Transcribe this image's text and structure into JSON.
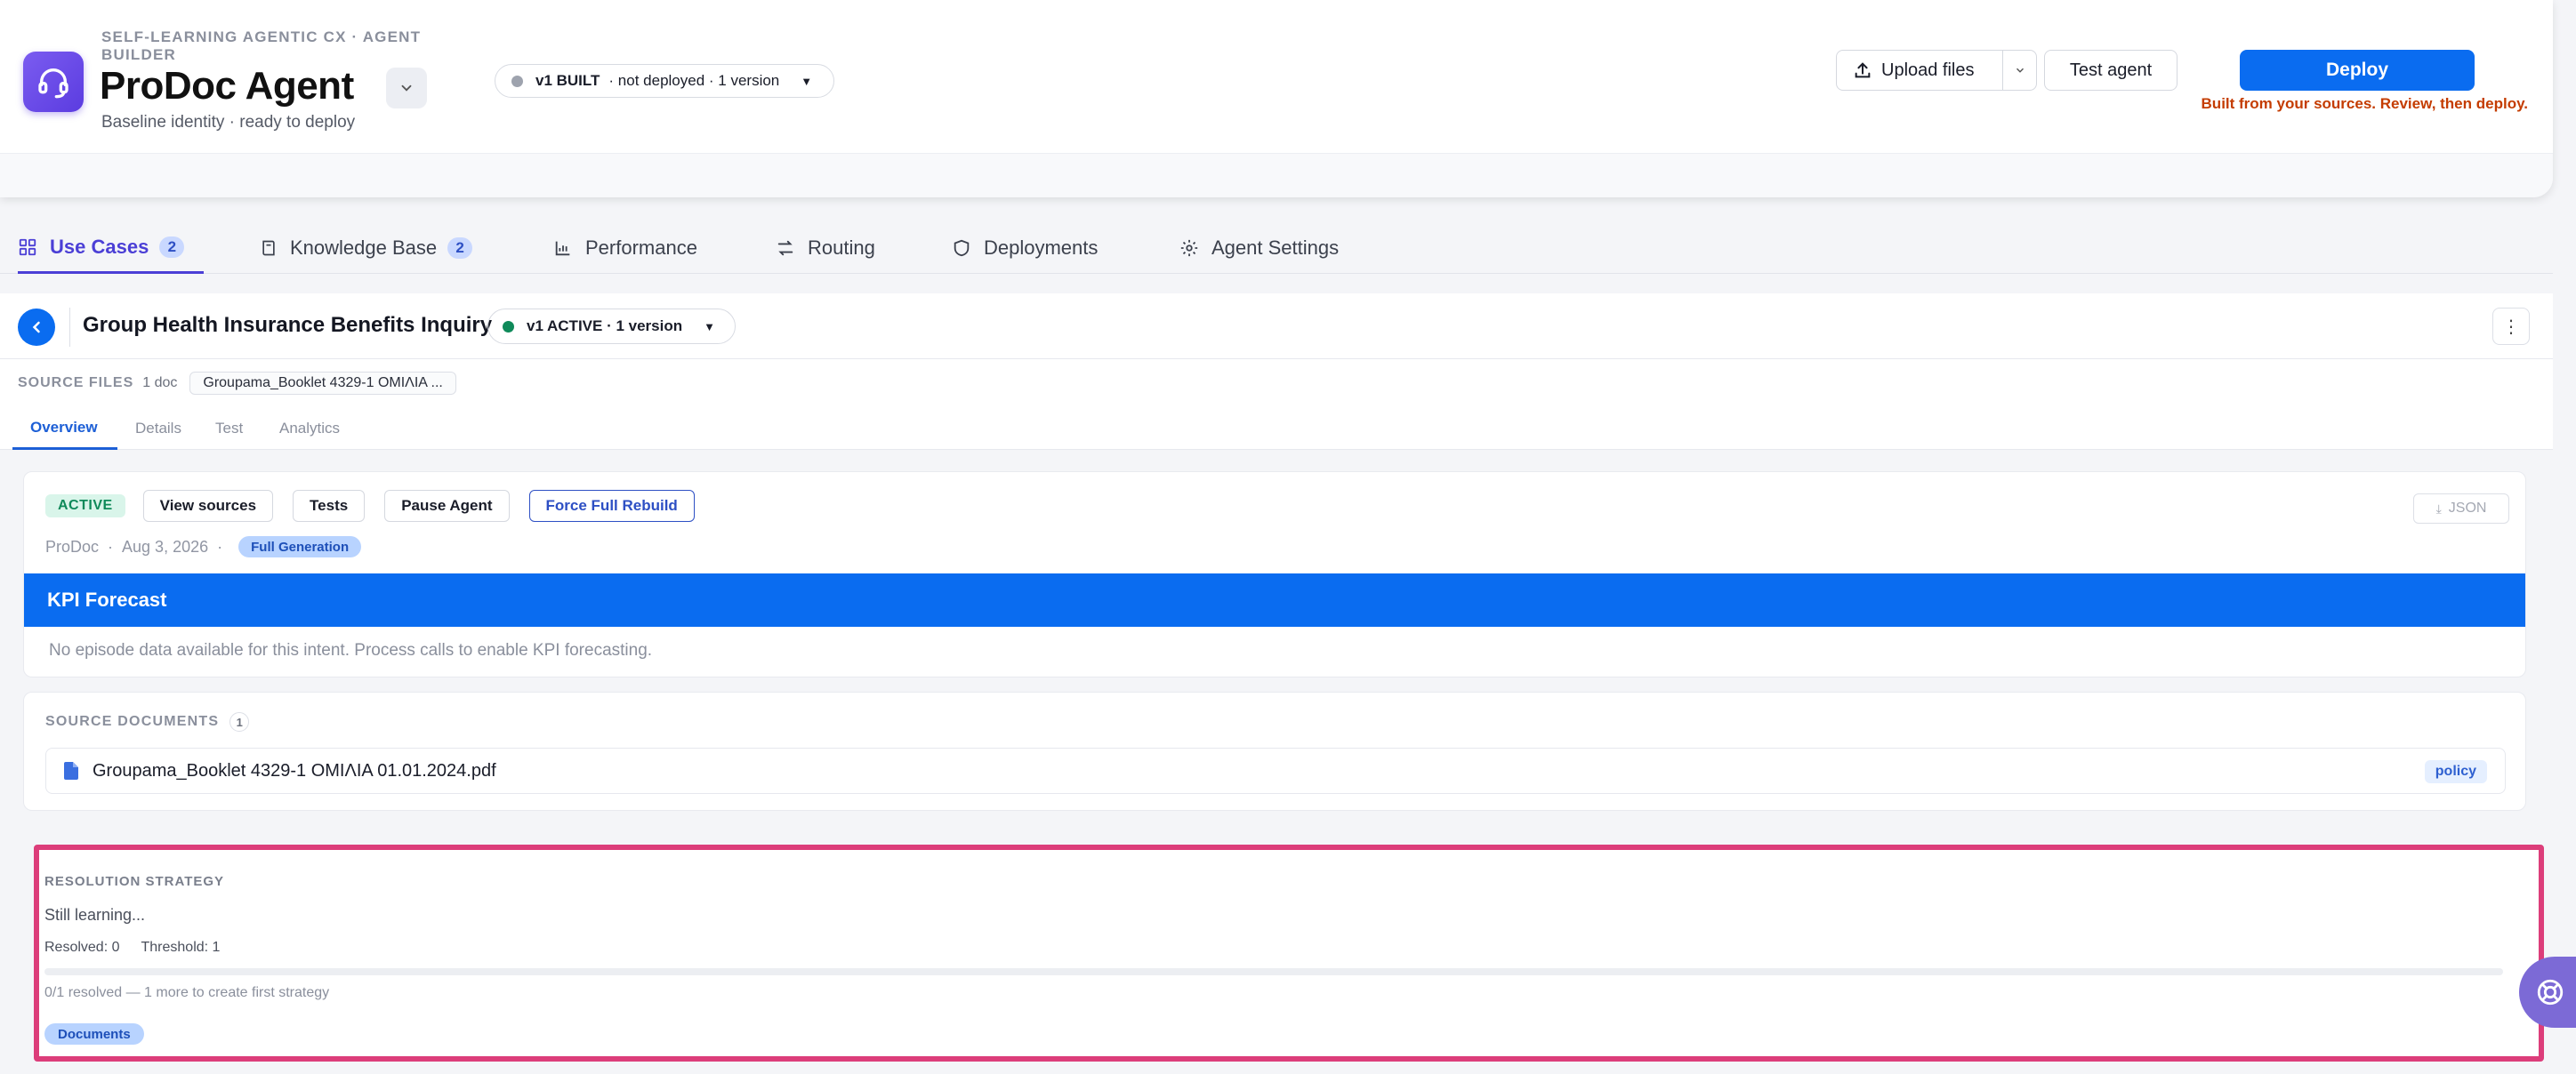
{
  "header": {
    "breadcrumb": "SELF-LEARNING AGENTIC CX · AGENT BUILDER",
    "title": "ProDoc Agent",
    "subtitle": "Baseline identity · ready to deploy",
    "version": {
      "label": "v1 BUILT",
      "status": "· not deployed · 1 version",
      "dot_color": "#9ea3ae"
    },
    "upload_label": "Upload files",
    "test_label": "Test agent",
    "deploy_label": "Deploy",
    "deploy_note": "Built from your sources. Review, then deploy.",
    "accent": "#0a6cf0",
    "note_color": "#c43c00"
  },
  "tabs": [
    {
      "label": "Use Cases",
      "badge": "2",
      "icon": "grid-icon"
    },
    {
      "label": "Knowledge Base",
      "badge": "2",
      "icon": "book-icon"
    },
    {
      "label": "Performance",
      "icon": "bar-chart-icon"
    },
    {
      "label": "Routing",
      "icon": "routing-arrows-icon"
    },
    {
      "label": "Deployments",
      "icon": "shield-icon"
    },
    {
      "label": "Agent Settings",
      "icon": "gear-icon"
    }
  ],
  "usecase": {
    "title": "Group Health Insurance Benefits Inquiry",
    "version_label": "v1 ACTIVE · 1 version",
    "version_dot_color": "#0f8a5a",
    "source_files_label": "SOURCE FILES",
    "source_files_count": "1 doc",
    "source_file_chip": "Groupama_Booklet 4329-1 ΟΜΙΛΙΑ ...",
    "subtabs": [
      "Overview",
      "Details",
      "Test",
      "Analytics"
    ]
  },
  "overview": {
    "status": "ACTIVE",
    "actions": [
      "View sources",
      "Tests",
      "Pause Agent",
      "Force Full Rebuild"
    ],
    "json_label": "JSON",
    "meta_source": "ProDoc",
    "meta_date": "Aug 3, 2026",
    "meta_badge": "Full Generation",
    "kpi_title": "KPI Forecast",
    "kpi_empty": "No episode data available for this intent. Process calls to enable KPI forecasting."
  },
  "source_documents": {
    "heading": "SOURCE DOCUMENTS",
    "count": "1",
    "items": [
      {
        "name": "Groupama_Booklet 4329-1 ΟΜΙΛΙΑ 01.01.2024.pdf",
        "tag": "policy"
      }
    ]
  },
  "resolution": {
    "heading": "RESOLUTION STRATEGY",
    "state": "Still learning...",
    "resolved": "Resolved: 0",
    "threshold": "Threshold: 1",
    "progress_fraction": 0,
    "caption": "0/1 resolved — 1 more to create first strategy",
    "tag": "Documents",
    "highlight_color": "#dc3d7a"
  }
}
